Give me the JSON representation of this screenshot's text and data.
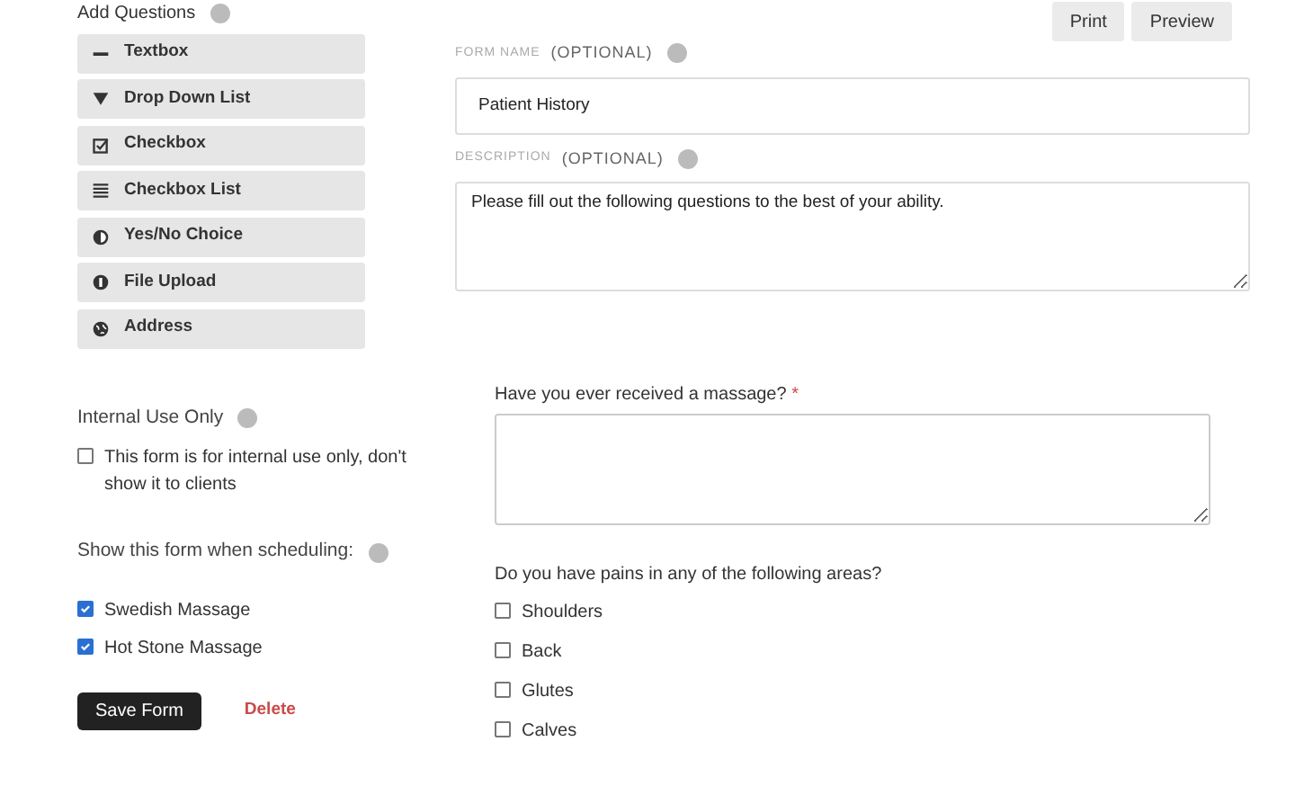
{
  "add_questions": {
    "title": "Add Questions",
    "items": [
      {
        "label": "Textbox",
        "kind": "textbox"
      },
      {
        "label": "Drop Down List",
        "kind": "dropdown"
      },
      {
        "label": "Checkbox",
        "kind": "checkbox"
      },
      {
        "label": "Checkbox List",
        "kind": "list"
      },
      {
        "label": "Yes/No Choice",
        "kind": "yesno"
      },
      {
        "label": "File Upload",
        "kind": "upload"
      },
      {
        "label": "Address",
        "kind": "address"
      }
    ]
  },
  "internal_use": {
    "title": "Internal Use Only",
    "option": {
      "label": "This form is for internal use only, don't show it to clients",
      "checked": false
    }
  },
  "scheduling": {
    "title": "Show this form when scheduling:",
    "options": [
      {
        "label": "Swedish Massage",
        "checked": true
      },
      {
        "label": "Hot Stone Massage",
        "checked": true
      }
    ]
  },
  "actions": {
    "save": "Save Form",
    "delete": "Delete"
  },
  "toolbar": [
    "Print",
    "Preview"
  ],
  "form_name": {
    "label": "FORM NAME",
    "optional": "(OPTIONAL)",
    "value": "Patient History"
  },
  "description": {
    "label": "DESCRIPTION",
    "optional": "(OPTIONAL)",
    "value": "Please fill out the following questions to the best of your ability."
  },
  "questions": [
    {
      "kind": "textarea",
      "label": "Have you ever received a massage?",
      "required": true,
      "required_mark": "*"
    },
    {
      "kind": "checkbox_list",
      "label": "Do you have pains in any of the following areas?",
      "required": false,
      "options": [
        {
          "label": "Shoulders",
          "checked": false
        },
        {
          "label": "Back",
          "checked": false
        },
        {
          "label": "Glutes",
          "checked": false
        },
        {
          "label": "Calves",
          "checked": false
        }
      ]
    }
  ]
}
